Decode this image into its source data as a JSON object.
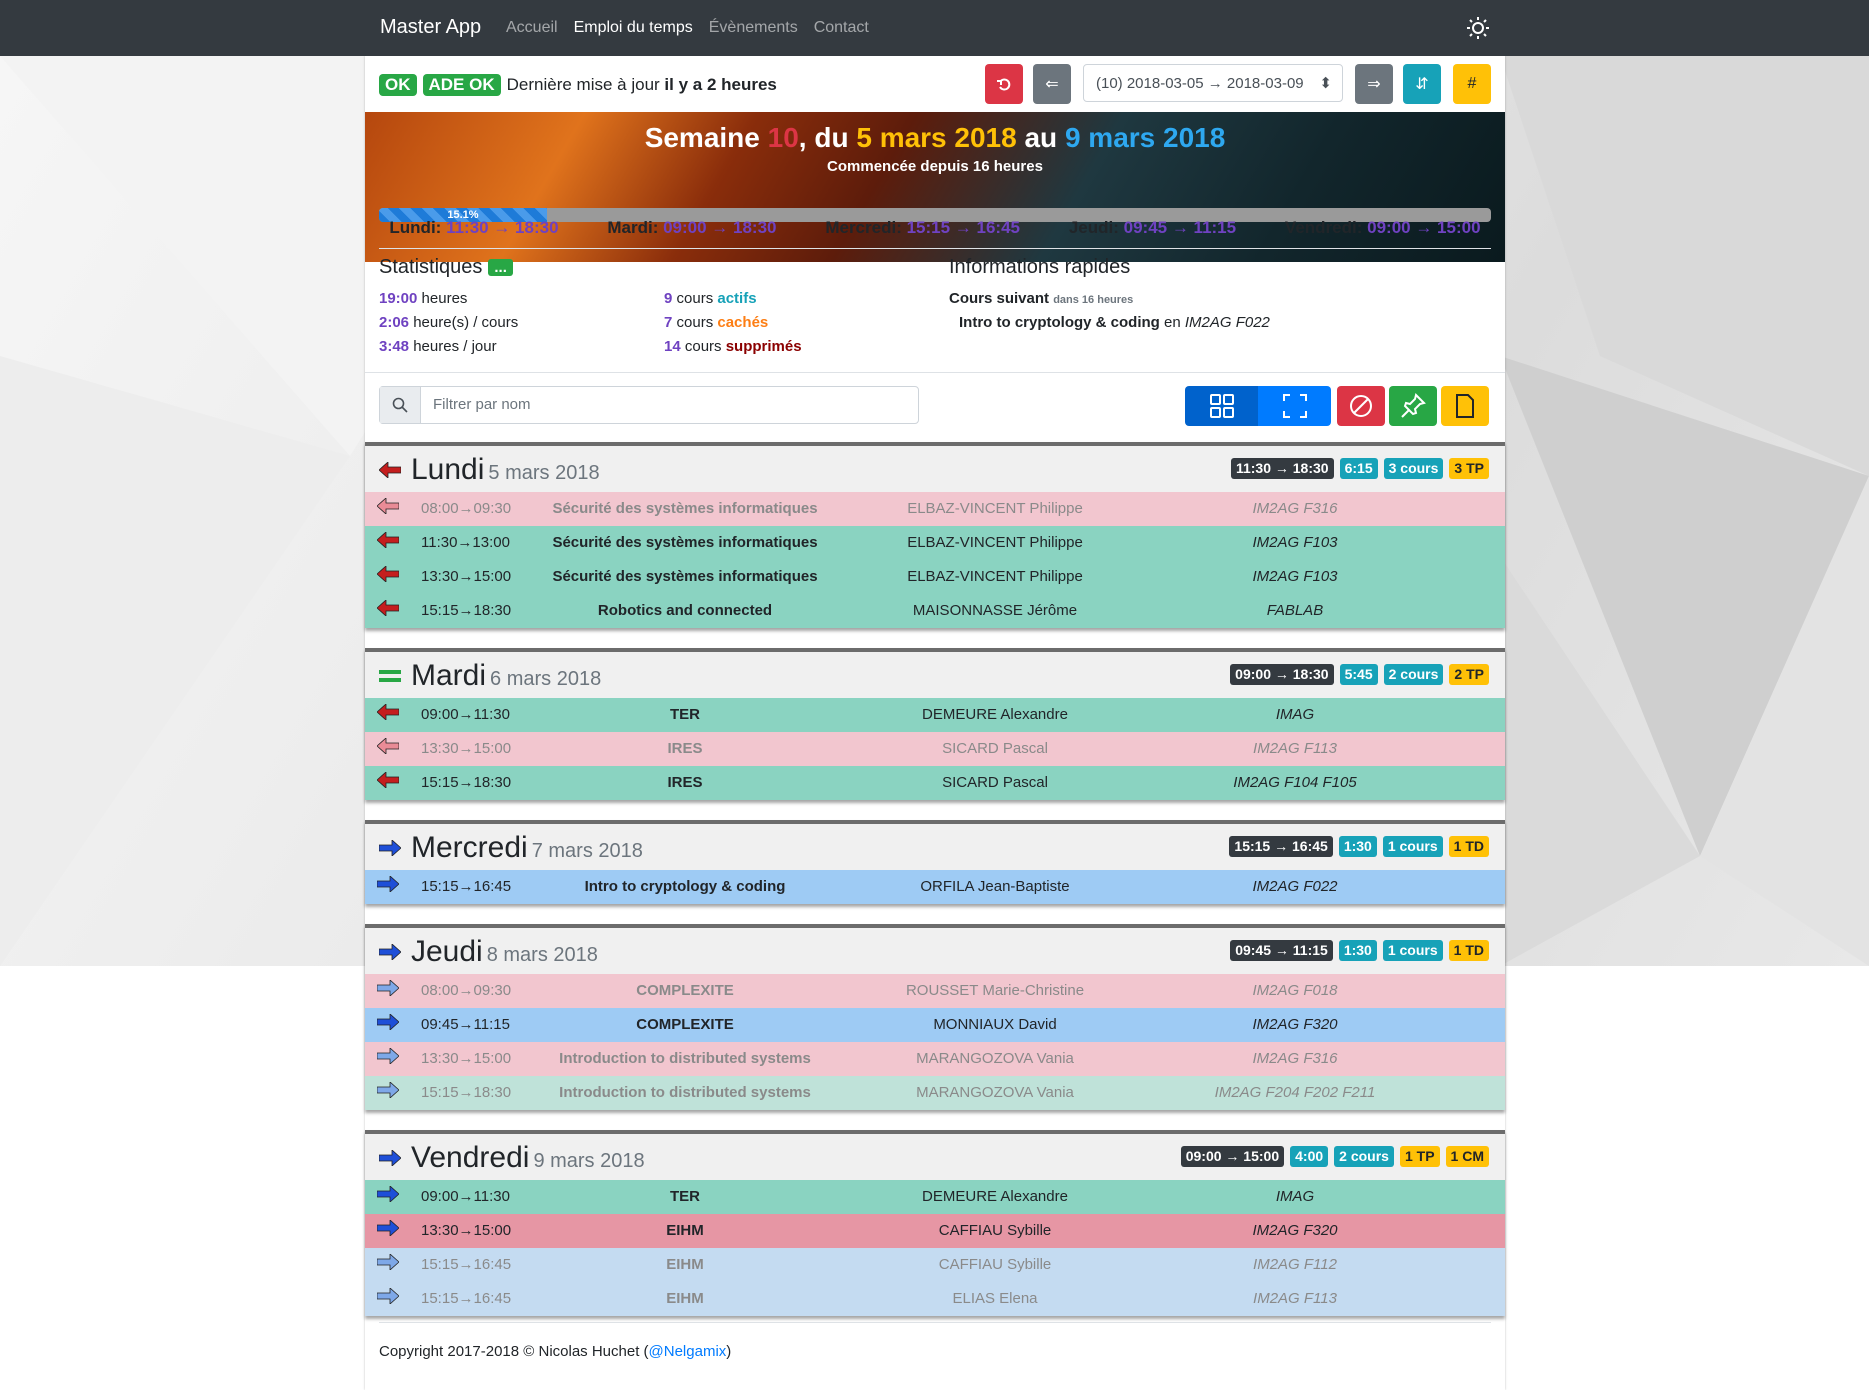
{
  "navbar": {
    "brand": "Master App",
    "links": [
      "Accueil",
      "Emploi du temps",
      "Évènements",
      "Contact"
    ]
  },
  "top": {
    "status_ok": "OK",
    "status_ade": "ADE OK",
    "update_text": "Dernière mise à jour",
    "update_ago": "il y a 2 heures",
    "week_select": "(10) 2018-03-05 → 2018-03-09",
    "hash": "#"
  },
  "banner": {
    "semaine": "Semaine",
    "week": "10",
    "du": ", du",
    "from": "5 mars 2018",
    "au": "au",
    "to": "9 mars 2018",
    "subtitle": "Commencée depuis 16 heures",
    "progress_label": "15.1%",
    "progress": 0.151
  },
  "summary": [
    {
      "day": "Lundi",
      "time": "11:30 → 18:30"
    },
    {
      "day": "Mardi",
      "time": "09:00 → 18:30"
    },
    {
      "day": "Mercredi",
      "time": "15:15 → 16:45"
    },
    {
      "day": "Jeudi",
      "time": "09:45 → 11:15"
    },
    {
      "day": "Vendredi",
      "time": "09:00 → 15:00"
    }
  ],
  "stats": {
    "title": "Statistiques",
    "more": "...",
    "hours": "19:00",
    "hours_label": "heures",
    "per_course": "2:06",
    "per_course_label": "heure(s) / cours",
    "per_day": "3:48",
    "per_day_label": "heures / jour",
    "active_n": "9",
    "active_pre": "cours",
    "active_label": "actifs",
    "hidden_n": "7",
    "hidden_pre": "cours",
    "hidden_label": "cachés",
    "deleted_n": "14",
    "deleted_pre": "cours",
    "deleted_label": "supprimés"
  },
  "quick": {
    "title": "Informations rapides",
    "next": "Cours suivant",
    "next_in": "dans 16 heures",
    "course": "Intro to cryptology & coding",
    "en": "en",
    "room": "IM2AG F022"
  },
  "search": {
    "placeholder": "Filtrer par nom"
  },
  "days": [
    {
      "name": "Lundi",
      "date": "5 mars 2018",
      "badges": [
        "11:30 → 18:30",
        "6:15",
        "3 cours",
        "3 TP"
      ],
      "rows": [
        {
          "time": "08:00→09:30",
          "course": "Sécurité des systèmes informatiques",
          "prof": "ELBAZ-VINCENT Philippe",
          "room": "IM2AG F316"
        },
        {
          "time": "11:30→13:00",
          "course": "Sécurité des systèmes informatiques",
          "prof": "ELBAZ-VINCENT Philippe",
          "room": "IM2AG F103"
        },
        {
          "time": "13:30→15:00",
          "course": "Sécurité des systèmes informatiques",
          "prof": "ELBAZ-VINCENT Philippe",
          "room": "IM2AG F103"
        },
        {
          "time": "15:15→18:30",
          "course": "Robotics and connected",
          "prof": "MAISONNASSE Jérôme",
          "room": "FABLAB"
        }
      ]
    },
    {
      "name": "Mardi",
      "date": "6 mars 2018",
      "badges": [
        "09:00 → 18:30",
        "5:45",
        "2 cours",
        "2 TP"
      ],
      "rows": [
        {
          "time": "09:00→11:30",
          "course": "TER",
          "prof": "DEMEURE Alexandre",
          "room": "IMAG"
        },
        {
          "time": "13:30→15:00",
          "course": "IRES",
          "prof": "SICARD Pascal",
          "room": "IM2AG F113"
        },
        {
          "time": "15:15→18:30",
          "course": "IRES",
          "prof": "SICARD Pascal",
          "room": "IM2AG F104 F105"
        }
      ]
    },
    {
      "name": "Mercredi",
      "date": "7 mars 2018",
      "badges": [
        "15:15 → 16:45",
        "1:30",
        "1 cours",
        "1 TD"
      ],
      "rows": [
        {
          "time": "15:15→16:45",
          "course": "Intro to cryptology & coding",
          "prof": "ORFILA Jean-Baptiste",
          "room": "IM2AG F022"
        }
      ]
    },
    {
      "name": "Jeudi",
      "date": "8 mars 2018",
      "badges": [
        "09:45 → 11:15",
        "1:30",
        "1 cours",
        "1 TD"
      ],
      "rows": [
        {
          "time": "08:00→09:30",
          "course": "COMPLEXITE",
          "prof": "ROUSSET Marie-Christine",
          "room": "IM2AG F018"
        },
        {
          "time": "09:45→11:15",
          "course": "COMPLEXITE",
          "prof": "MONNIAUX David",
          "room": "IM2AG F320"
        },
        {
          "time": "13:30→15:00",
          "course": "Introduction to distributed systems",
          "prof": "MARANGOZOVA Vania",
          "room": "IM2AG F316"
        },
        {
          "time": "15:15→18:30",
          "course": "Introduction to distributed systems",
          "prof": "MARANGOZOVA Vania",
          "room": "IM2AG F204 F202 F211"
        }
      ]
    },
    {
      "name": "Vendredi",
      "date": "9 mars 2018",
      "badges": [
        "09:00 → 15:00",
        "4:00",
        "2 cours",
        "1 TP",
        "1 CM"
      ],
      "rows": [
        {
          "time": "09:00→11:30",
          "course": "TER",
          "prof": "DEMEURE Alexandre",
          "room": "IMAG"
        },
        {
          "time": "13:30→15:00",
          "course": "EIHM",
          "prof": "CAFFIAU Sybille",
          "room": "IM2AG F320"
        },
        {
          "time": "15:15→16:45",
          "course": "EIHM",
          "prof": "CAFFIAU Sybille",
          "room": "IM2AG F112"
        },
        {
          "time": "15:15→16:45",
          "course": "EIHM",
          "prof": "ELIAS Elena",
          "room": "IM2AG F113"
        }
      ]
    }
  ],
  "footer": {
    "text": "Copyright 2017-2018 © Nicolas Huchet (",
    "handle": "@Nelgamix",
    "close": ")"
  }
}
